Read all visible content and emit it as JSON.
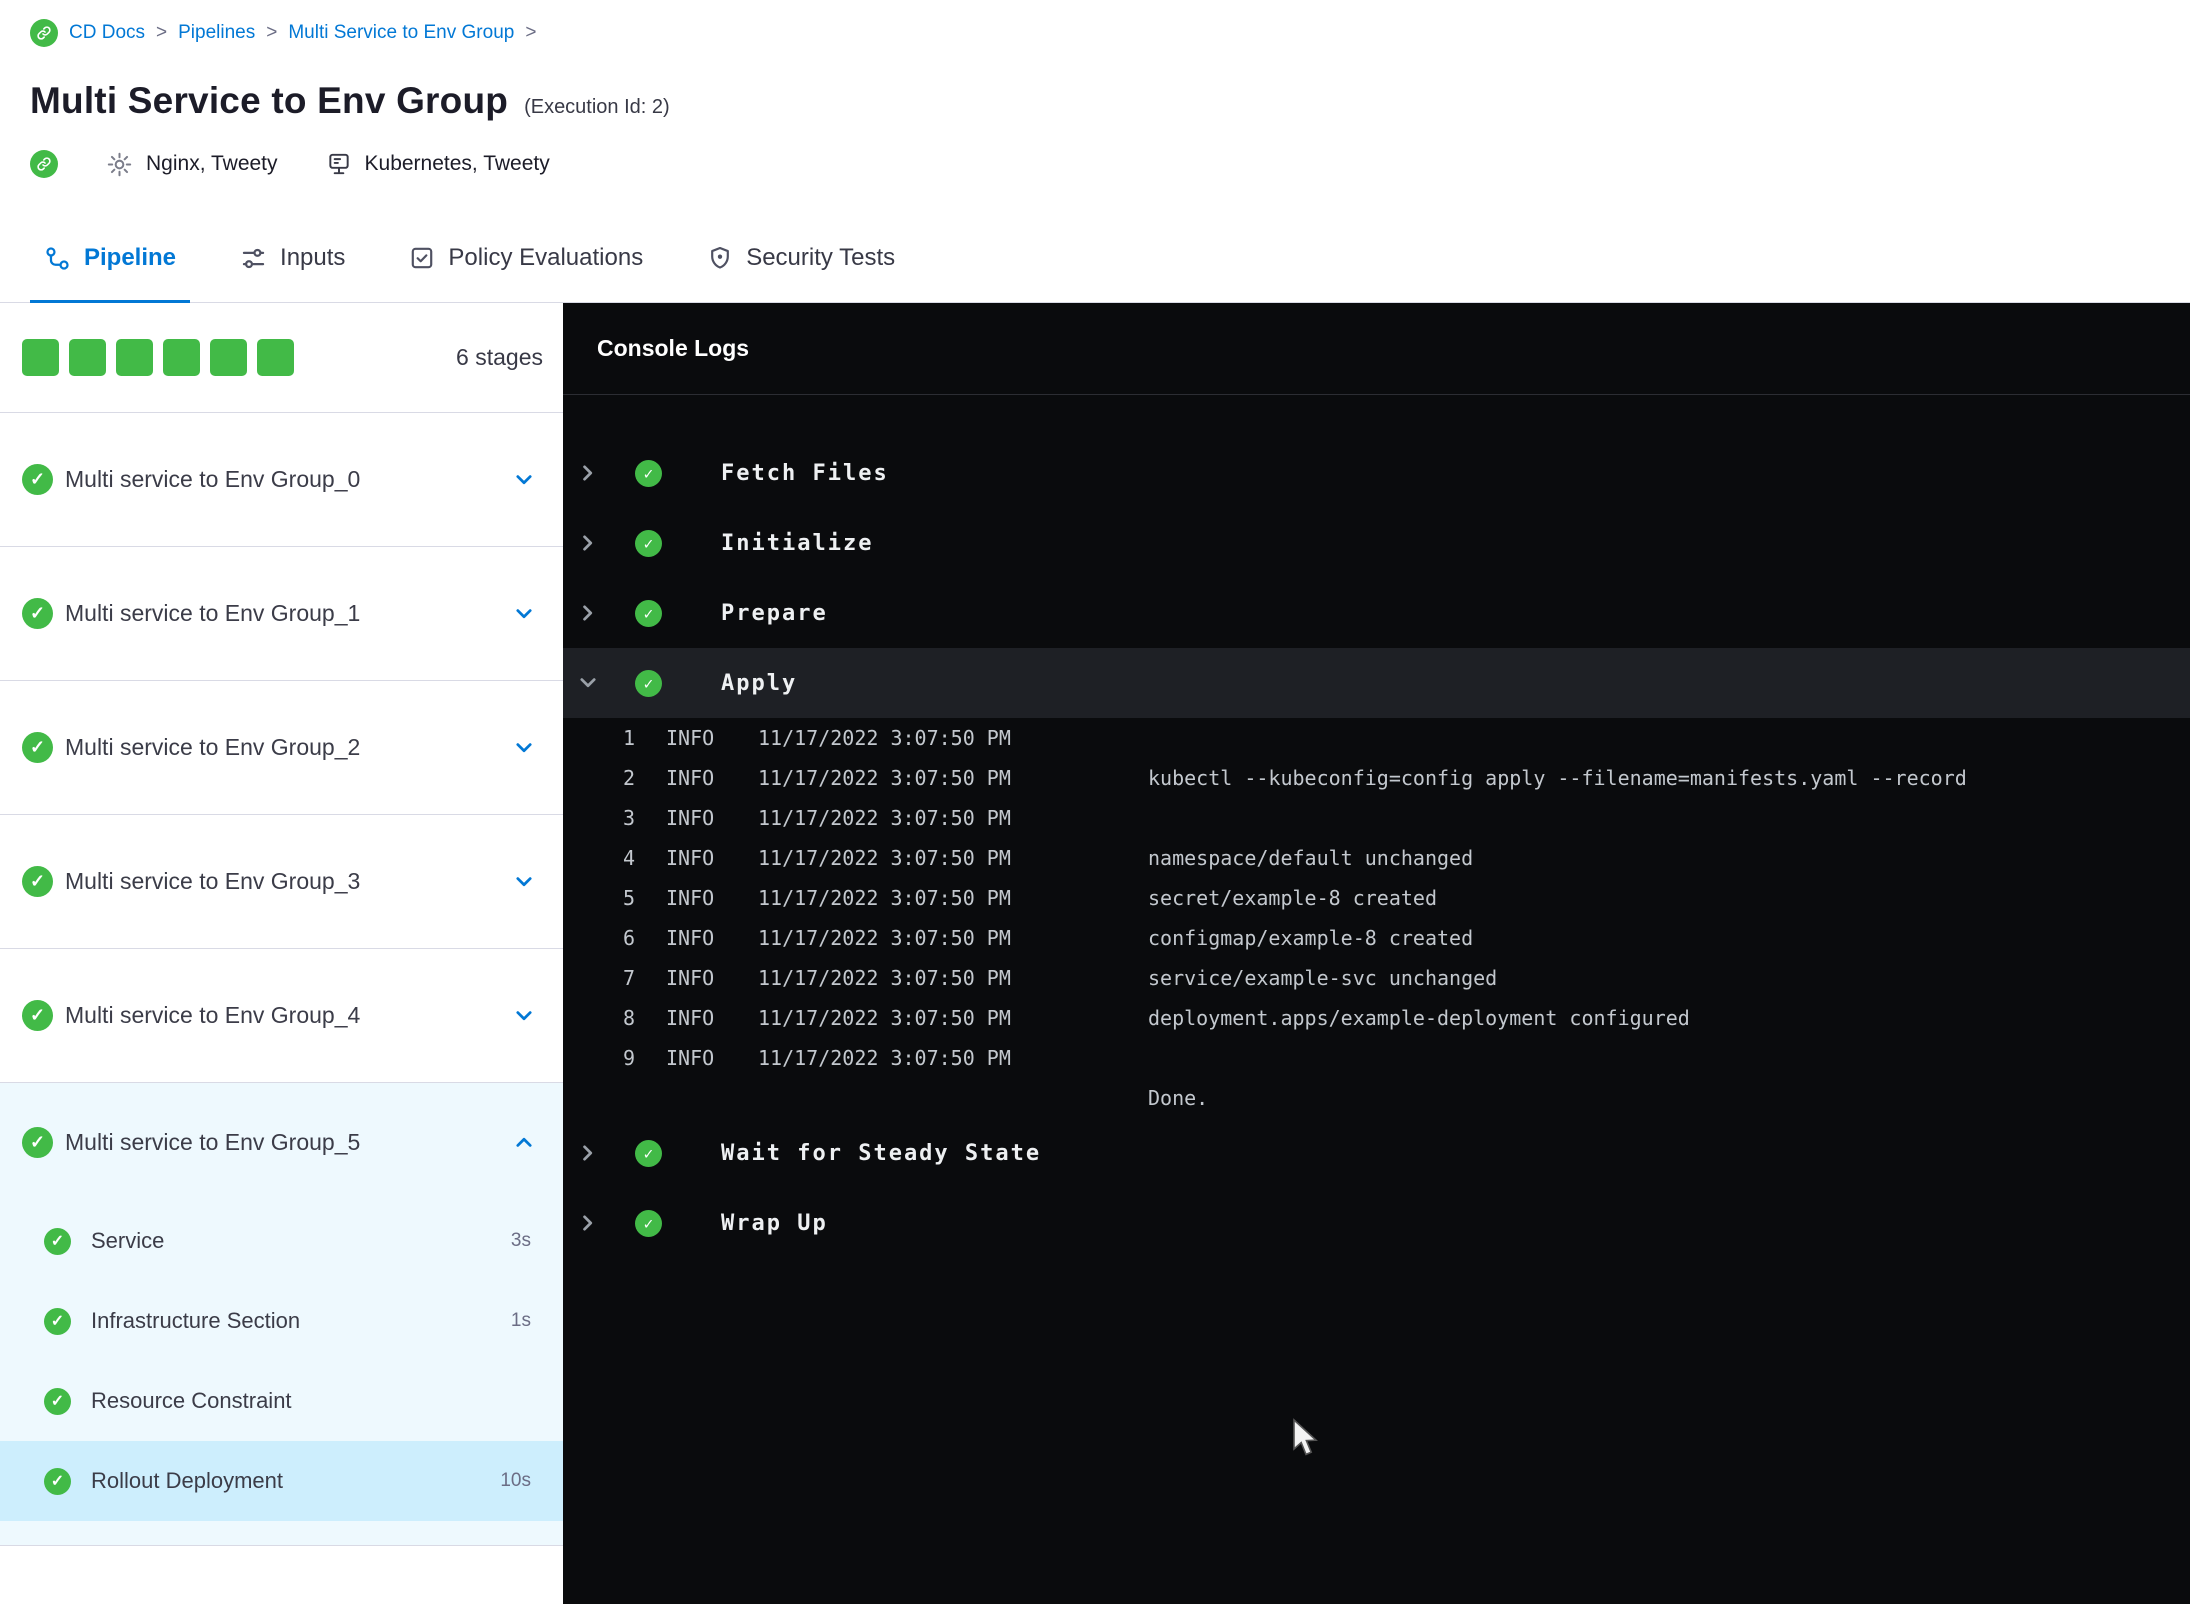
{
  "colors": {
    "accent_blue": "#0278d5",
    "success_green": "#42ba47",
    "console_bg": "#0a0b0d",
    "expanded_bg": "#eef9fe",
    "selected_step_bg": "#cdeefd"
  },
  "breadcrumb": {
    "leading_icon": "link-icon",
    "items": [
      {
        "label": "CD Docs"
      },
      {
        "label": "Pipelines"
      },
      {
        "label": "Multi Service to Env Group"
      }
    ]
  },
  "header": {
    "title": "Multi Service to Env Group",
    "execution_id": "(Execution Id: 2)",
    "meta": [
      {
        "icon": "link-icon",
        "label": ""
      },
      {
        "icon": "gear-icon",
        "label": "Nginx, Tweety"
      },
      {
        "icon": "rack-icon",
        "label": "Kubernetes, Tweety"
      }
    ]
  },
  "tabs": [
    {
      "label": "Pipeline",
      "icon": "pipeline-icon",
      "active": true
    },
    {
      "label": "Inputs",
      "icon": "inputs-icon",
      "active": false
    },
    {
      "label": "Policy Evaluations",
      "icon": "policy-icon",
      "active": false
    },
    {
      "label": "Security Tests",
      "icon": "security-icon",
      "active": false
    }
  ],
  "sidebar": {
    "stage_square_count": 6,
    "stage_count_label": "6 stages",
    "stages": [
      {
        "label": "Multi service to Env Group_0",
        "status": "success",
        "expanded": false
      },
      {
        "label": "Multi service to Env Group_1",
        "status": "success",
        "expanded": false
      },
      {
        "label": "Multi service to Env Group_2",
        "status": "success",
        "expanded": false
      },
      {
        "label": "Multi service to Env Group_3",
        "status": "success",
        "expanded": false
      },
      {
        "label": "Multi service to Env Group_4",
        "status": "success",
        "expanded": false
      },
      {
        "label": "Multi service to Env Group_5",
        "status": "success",
        "expanded": true,
        "steps": [
          {
            "label": "Service",
            "duration": "3s",
            "selected": false
          },
          {
            "label": "Infrastructure Section",
            "duration": "1s",
            "selected": false
          },
          {
            "label": "Resource Constraint",
            "duration": "",
            "selected": false
          },
          {
            "label": "Rollout Deployment",
            "duration": "10s",
            "selected": true
          }
        ]
      }
    ]
  },
  "console": {
    "title": "Console Logs",
    "sections": [
      {
        "label": "Fetch Files",
        "status": "success",
        "expanded": false
      },
      {
        "label": "Initialize",
        "status": "success",
        "expanded": false
      },
      {
        "label": "Prepare",
        "status": "success",
        "expanded": false
      },
      {
        "label": "Apply",
        "status": "success",
        "expanded": true,
        "lines": [
          {
            "num": "1",
            "level": "INFO",
            "time": "11/17/2022 3:07:50 PM",
            "msg": ""
          },
          {
            "num": "2",
            "level": "INFO",
            "time": "11/17/2022 3:07:50 PM",
            "msg": "kubectl --kubeconfig=config apply --filename=manifests.yaml --record"
          },
          {
            "num": "3",
            "level": "INFO",
            "time": "11/17/2022 3:07:50 PM",
            "msg": ""
          },
          {
            "num": "4",
            "level": "INFO",
            "time": "11/17/2022 3:07:50 PM",
            "msg": "namespace/default unchanged"
          },
          {
            "num": "5",
            "level": "INFO",
            "time": "11/17/2022 3:07:50 PM",
            "msg": "secret/example-8 created"
          },
          {
            "num": "6",
            "level": "INFO",
            "time": "11/17/2022 3:07:50 PM",
            "msg": "configmap/example-8 created"
          },
          {
            "num": "7",
            "level": "INFO",
            "time": "11/17/2022 3:07:50 PM",
            "msg": "service/example-svc unchanged"
          },
          {
            "num": "8",
            "level": "INFO",
            "time": "11/17/2022 3:07:50 PM",
            "msg": "deployment.apps/example-deployment configured"
          },
          {
            "num": "9",
            "level": "INFO",
            "time": "11/17/2022 3:07:50 PM",
            "msg": ""
          },
          {
            "num": "",
            "level": "",
            "time": "",
            "msg": "Done."
          }
        ]
      },
      {
        "label": "Wait for Steady State",
        "status": "success",
        "expanded": false
      },
      {
        "label": "Wrap Up",
        "status": "success",
        "expanded": false
      }
    ]
  }
}
